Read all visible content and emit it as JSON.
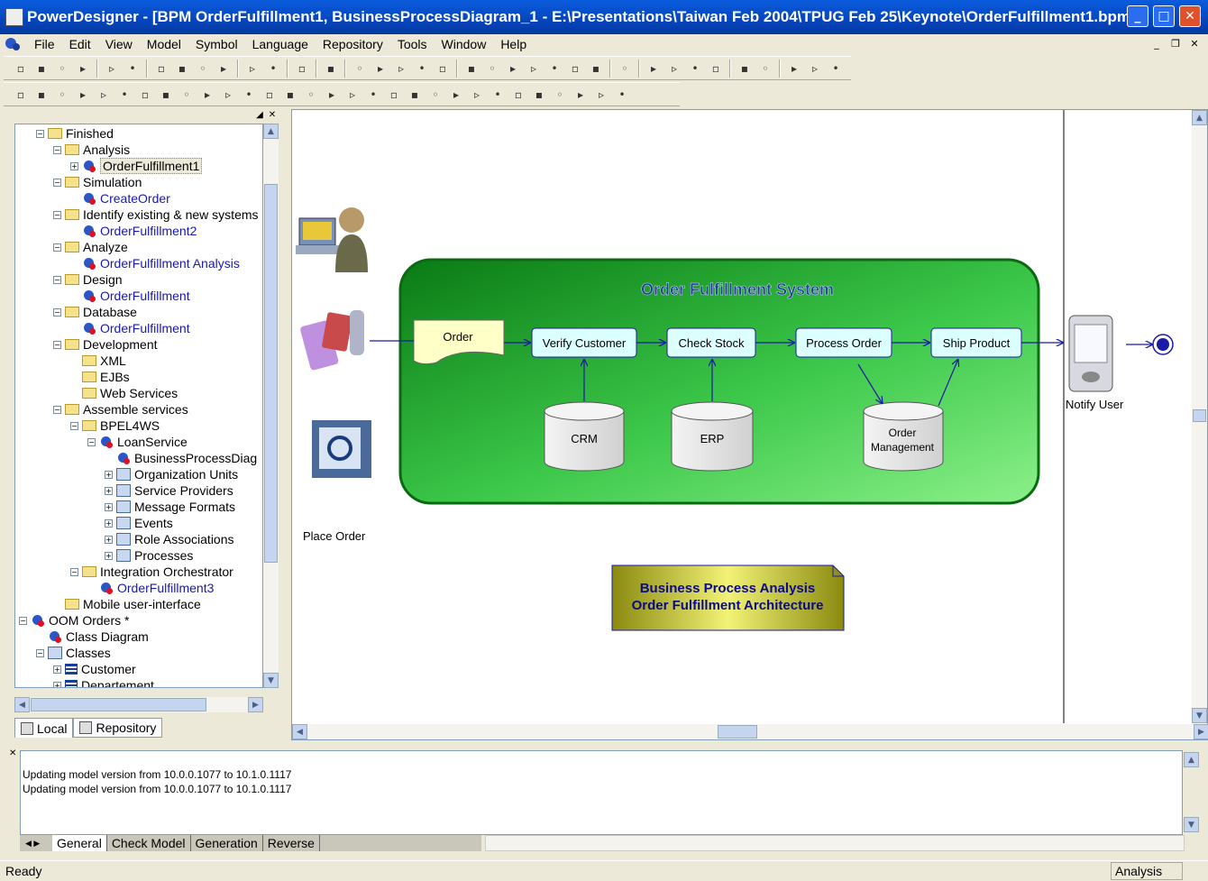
{
  "window": {
    "title": "PowerDesigner - [BPM OrderFulfillment1, BusinessProcessDiagram_1 - E:\\Presentations\\Taiwan Feb 2004\\TPUG Feb 25\\Keynote\\OrderFulfillment1.bpm]"
  },
  "menu": [
    "File",
    "Edit",
    "View",
    "Model",
    "Symbol",
    "Language",
    "Repository",
    "Tools",
    "Window",
    "Help"
  ],
  "tree": [
    {
      "label": "Finished",
      "type": "folder",
      "level": 1,
      "exp": "-"
    },
    {
      "label": "Analysis",
      "type": "folder",
      "level": 2,
      "exp": "-"
    },
    {
      "label": "OrderFulfillment1",
      "type": "bpm",
      "level": 3,
      "exp": "+",
      "style": "sel"
    },
    {
      "label": "Simulation",
      "type": "folder",
      "level": 2,
      "exp": "-"
    },
    {
      "label": "CreateOrder",
      "type": "bpm",
      "level": 3,
      "style": "link"
    },
    {
      "label": "Identify existing & new systems",
      "type": "folder",
      "level": 2,
      "exp": "-"
    },
    {
      "label": "OrderFulfillment2",
      "type": "bpm",
      "level": 3,
      "style": "link"
    },
    {
      "label": "Analyze",
      "type": "folder",
      "level": 2,
      "exp": "-"
    },
    {
      "label": "OrderFulfillment Analysis",
      "type": "bpm",
      "level": 3,
      "style": "link"
    },
    {
      "label": "Design",
      "type": "folder",
      "level": 2,
      "exp": "-"
    },
    {
      "label": "OrderFulfillment",
      "type": "bpm",
      "level": 3,
      "style": "link"
    },
    {
      "label": "Database",
      "type": "folder",
      "level": 2,
      "exp": "-"
    },
    {
      "label": "OrderFulfillment",
      "type": "bpm",
      "level": 3,
      "style": "link"
    },
    {
      "label": "Development",
      "type": "folder",
      "level": 2,
      "exp": "-"
    },
    {
      "label": "XML",
      "type": "folder",
      "level": 3
    },
    {
      "label": "EJBs",
      "type": "folder",
      "level": 3
    },
    {
      "label": "Web Services",
      "type": "folder",
      "level": 3
    },
    {
      "label": "Assemble services",
      "type": "folder",
      "level": 2,
      "exp": "-"
    },
    {
      "label": "BPEL4WS",
      "type": "folder",
      "level": 3,
      "exp": "-"
    },
    {
      "label": "LoanService",
      "type": "bpm",
      "level": 4,
      "exp": "-"
    },
    {
      "label": "BusinessProcessDiag",
      "type": "bpm",
      "level": 5
    },
    {
      "label": "Organization Units",
      "type": "pkg",
      "level": 5,
      "exp": "+"
    },
    {
      "label": "Service Providers",
      "type": "pkg",
      "level": 5,
      "exp": "+"
    },
    {
      "label": "Message Formats",
      "type": "pkg",
      "level": 5,
      "exp": "+"
    },
    {
      "label": "Events",
      "type": "pkg",
      "level": 5,
      "exp": "+"
    },
    {
      "label": "Role Associations",
      "type": "pkg",
      "level": 5,
      "exp": "+"
    },
    {
      "label": "Processes",
      "type": "pkg",
      "level": 5,
      "exp": "+"
    },
    {
      "label": "Integration Orchestrator",
      "type": "folder",
      "level": 3,
      "exp": "-"
    },
    {
      "label": "OrderFulfillment3",
      "type": "bpm",
      "level": 4,
      "style": "link"
    },
    {
      "label": "Mobile user-interface",
      "type": "folder",
      "level": 2
    },
    {
      "label": "OOM Orders *",
      "type": "bpm",
      "level": 0,
      "exp": "-"
    },
    {
      "label": "Class Diagram",
      "type": "bpm",
      "level": 1
    },
    {
      "label": "Classes",
      "type": "pkg",
      "level": 1,
      "exp": "-"
    },
    {
      "label": "Customer",
      "type": "cls",
      "level": 2,
      "exp": "+"
    },
    {
      "label": "Departement",
      "type": "cls",
      "level": 2,
      "exp": "+"
    }
  ],
  "browser_tabs": {
    "local": "Local",
    "repository": "Repository"
  },
  "diagram": {
    "system_title": "Order Fulfillment System",
    "order": "Order",
    "verify": "Verify Customer",
    "check": "Check Stock",
    "process": "Process Order",
    "ship": "Ship Product",
    "crm": "CRM",
    "erp": "ERP",
    "om1": "Order",
    "om2": "Management",
    "place_order": "Place Order",
    "notify_user": "Notify User",
    "note1": "Business Process Analysis",
    "note2": "Order Fulfillment Architecture"
  },
  "output": {
    "lines": [
      "Updating model version from 10.0.0.1077 to 10.1.0.1117",
      "Updating model version from 10.0.0.1077 to 10.1.0.1117"
    ],
    "tabs": [
      "General",
      "Check Model",
      "Generation",
      "Reverse"
    ]
  },
  "status": {
    "left": "Ready",
    "right": "Analysis"
  }
}
